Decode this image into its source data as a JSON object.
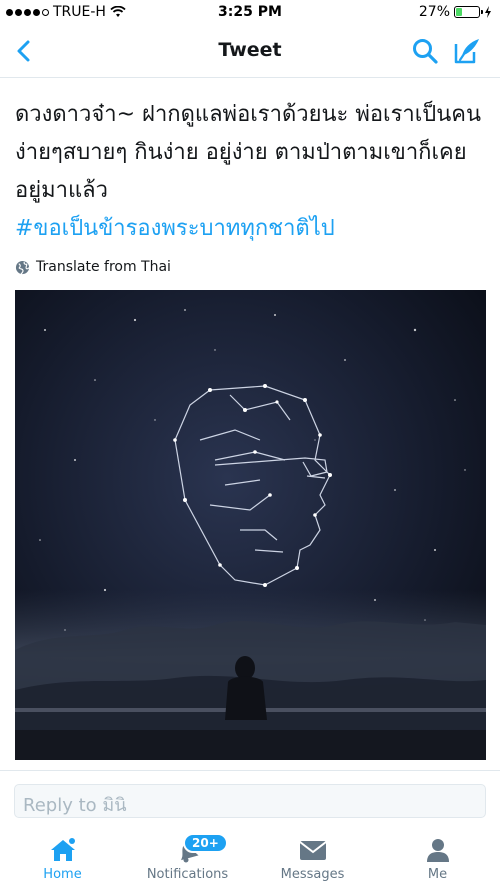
{
  "status_bar": {
    "carrier": "TRUE-H",
    "time": "3:25 PM",
    "battery": "27%",
    "battery_level": 0.27,
    "signal_bars": 4
  },
  "nav": {
    "title": "Tweet",
    "back_icon": "chevron-left-icon",
    "search_icon": "search-icon",
    "compose_icon": "compose-icon"
  },
  "tweet": {
    "text": "ดวงดาวจ๋า~ ฝากดูแลพ่อเราด้วยนะ พ่อเราเป็นคนง่ายๆสบายๆ กินง่าย อยู่ง่าย ตามป่าตามเขาก็เคยอยู่มาแล้ว",
    "hashtag": "#ขอเป็นข้ารองพระบาททุกชาติไป",
    "translate_label": "Translate from Thai",
    "translate_icon": "globe-icon"
  },
  "reply": {
    "placeholder": "Reply to มินิ"
  },
  "tabs": [
    {
      "label": "Home",
      "icon": "home-icon",
      "active": true
    },
    {
      "label": "Notifications",
      "icon": "bell-icon",
      "active": false,
      "badge": "20+"
    },
    {
      "label": "Messages",
      "icon": "envelope-icon",
      "active": false
    },
    {
      "label": "Me",
      "icon": "person-icon",
      "active": false
    }
  ],
  "colors": {
    "accent": "#1da1f2",
    "text": "#14171a",
    "muted": "#657786",
    "battery": "#4cd964"
  }
}
